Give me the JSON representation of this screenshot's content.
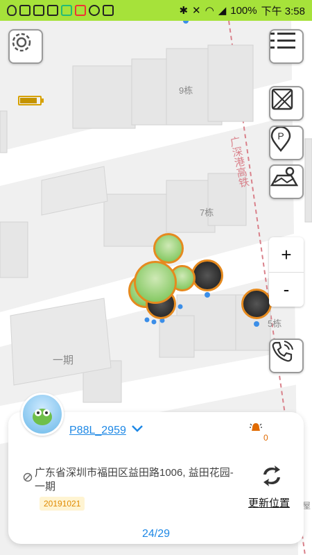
{
  "status_bar": {
    "battery_level": "100%",
    "time": "下午 3:58",
    "left_icons": [
      "qq-icon",
      "app-icon",
      "app-icon",
      "app-icon",
      "app-icon",
      "app-icon",
      "check-icon",
      "app-icon"
    ],
    "right_icons": [
      "bluetooth-icon",
      "mute-icon",
      "wifi-icon",
      "signal-icon"
    ]
  },
  "map": {
    "labels": {
      "building_9": "9栋",
      "building_7": "7栋",
      "building_5": "5栋",
      "area_1": "一期",
      "railway": "广深港高铁",
      "right_edge": "屋"
    }
  },
  "controls": {
    "settings_icon": "gear-icon",
    "list_icon": "menu-list-icon",
    "map_layer_icon": "map-layer-icon",
    "parking_icon": "parking-pin-icon",
    "satellite_icon": "satellite-map-icon",
    "zoom_in": "+",
    "zoom_out": "-",
    "call_icon": "phone-icon",
    "tracker_battery_level": 0.85
  },
  "device": {
    "name": "P88L_2959",
    "alarm_count": "0",
    "address": "广东省深圳市福田区益田路1006, 益田花园-一期",
    "date": "20191021",
    "refresh_label": "更新位置",
    "pager": "24/29"
  },
  "colors": {
    "status_bar_bg": "#a6e23a",
    "accent": "#1e88e5",
    "marker_border": "#e58a1f",
    "railway_label": "#d9808a"
  }
}
